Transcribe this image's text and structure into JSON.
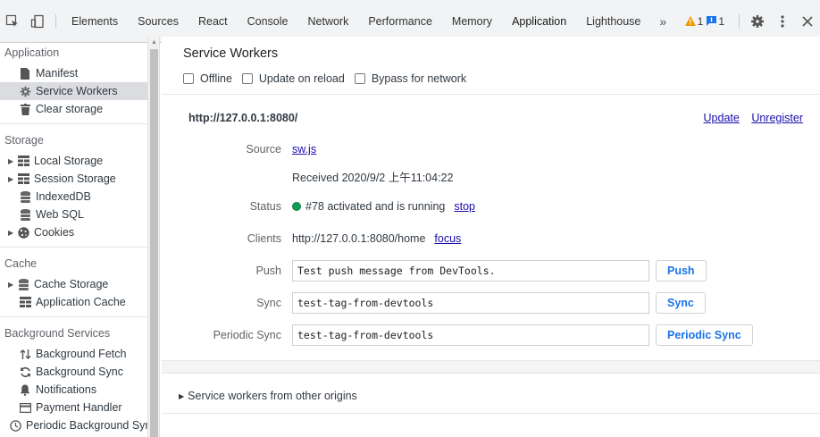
{
  "toolbar": {
    "tabs": [
      "Elements",
      "Sources",
      "React",
      "Console",
      "Network",
      "Performance",
      "Memory",
      "Application",
      "Lighthouse"
    ],
    "active_tab": "Application",
    "more": "»",
    "warnings_count": "1",
    "messages_count": "1"
  },
  "sidebar": {
    "sections": [
      {
        "title": "Application",
        "items": [
          {
            "label": "Manifest",
            "icon": "document-icon"
          },
          {
            "label": "Service Workers",
            "icon": "gear-icon",
            "selected": true
          },
          {
            "label": "Clear storage",
            "icon": "trash-icon"
          }
        ]
      },
      {
        "title": "Storage",
        "items": [
          {
            "label": "Local Storage",
            "icon": "grid-icon",
            "expandable": true
          },
          {
            "label": "Session Storage",
            "icon": "grid-icon",
            "expandable": true
          },
          {
            "label": "IndexedDB",
            "icon": "database-icon"
          },
          {
            "label": "Web SQL",
            "icon": "database-icon"
          },
          {
            "label": "Cookies",
            "icon": "cookie-icon",
            "expandable": true
          }
        ]
      },
      {
        "title": "Cache",
        "items": [
          {
            "label": "Cache Storage",
            "icon": "database-icon",
            "expandable": true
          },
          {
            "label": "Application Cache",
            "icon": "grid-icon"
          }
        ]
      },
      {
        "title": "Background Services",
        "items": [
          {
            "label": "Background Fetch",
            "icon": "arrows-updown-icon"
          },
          {
            "label": "Background Sync",
            "icon": "sync-icon"
          },
          {
            "label": "Notifications",
            "icon": "bell-icon"
          },
          {
            "label": "Payment Handler",
            "icon": "card-icon"
          },
          {
            "label": "Periodic Background Sync",
            "icon": "clock-icon"
          }
        ]
      }
    ]
  },
  "main": {
    "title": "Service Workers",
    "checkboxes": [
      {
        "label": "Offline",
        "checked": false
      },
      {
        "label": "Update on reload",
        "checked": false
      },
      {
        "label": "Bypass for network",
        "checked": false
      }
    ],
    "origin": "http://127.0.0.1:8080/",
    "update_link": "Update",
    "unregister_link": "Unregister",
    "source_label": "Source",
    "source_file": "sw.js",
    "received": "Received 2020/9/2 上午11:04:22",
    "status_label": "Status",
    "status_text": "#78 activated and is running",
    "status_color": "#0f9d58",
    "stop_link": "stop",
    "clients_label": "Clients",
    "clients_value": "http://127.0.0.1:8080/home",
    "focus_link": "focus",
    "push_label": "Push",
    "push_value": "Test push message from DevTools.",
    "push_button": "Push",
    "sync_label": "Sync",
    "sync_value": "test-tag-from-devtools",
    "sync_button": "Sync",
    "periodic_label": "Periodic Sync",
    "periodic_value": "test-tag-from-devtools",
    "periodic_button": "Periodic Sync",
    "other_origins": "Service workers from other origins"
  }
}
